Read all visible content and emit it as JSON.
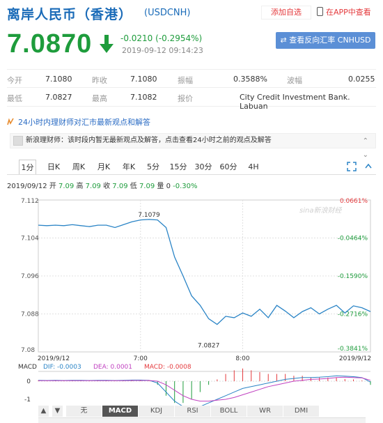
{
  "header": {
    "title": "离岸人民币（香港）",
    "code": "(USDCNH)",
    "add_favorite": "添加自选",
    "app_view": "在APP中查看"
  },
  "quote": {
    "price": "7.0870",
    "change": "-0.0210 (-0.2954%)",
    "timestamp": "2019-09-12 09:14:23",
    "reverse_button": "查看反向汇率 CNHUSD"
  },
  "stats": {
    "row1": [
      {
        "label": "今开",
        "value": "7.1080"
      },
      {
        "label": "昨收",
        "value": "7.1080"
      },
      {
        "label": "振幅",
        "value": "0.3588%"
      },
      {
        "label": "波幅",
        "value": "0.0255"
      }
    ],
    "row2": [
      {
        "label": "最低",
        "value": "7.0827"
      },
      {
        "label": "最高",
        "value": "7.1082"
      },
      {
        "label": "报价",
        "value": "City Credit Investment Bank. Labuan"
      }
    ]
  },
  "expert": {
    "heading": "24小时内理财师对汇市最新观点和解答",
    "notice": "新浪理财师：该时段内暂无最新观点及解答，点击查看24小时之前的观点及解答"
  },
  "tabs": [
    "1分",
    "日K",
    "周K",
    "月K",
    "年K",
    "5分",
    "15分",
    "30分",
    "60分",
    "4H"
  ],
  "active_tab": "1分",
  "ohlc_line": {
    "date": "2019/09/12",
    "open_label": "开",
    "open": "7.09",
    "high_label": "高",
    "high": "7.09",
    "close_label": "收",
    "close": "7.09",
    "low_label": "低",
    "low": "7.09",
    "vol_label": "量",
    "vol": "0",
    "pct": "-0.30%"
  },
  "chart_data": {
    "type": "line",
    "x": [
      "6:00",
      "6:05",
      "6:10",
      "6:15",
      "6:20",
      "6:25",
      "6:30",
      "6:35",
      "6:40",
      "6:45",
      "6:50",
      "6:55",
      "7:00",
      "7:05",
      "7:10",
      "7:15",
      "7:20",
      "7:25",
      "7:30",
      "7:35",
      "7:40",
      "7:45",
      "7:50",
      "7:55",
      "8:00",
      "8:05",
      "8:10",
      "8:15",
      "8:20",
      "8:25",
      "8:30",
      "8:35",
      "8:40",
      "8:45",
      "8:50",
      "8:55",
      "9:00",
      "9:05",
      "9:10",
      "9:15"
    ],
    "series": [
      {
        "values": [
          7.1067,
          7.1066,
          7.1067,
          7.1066,
          7.1068,
          7.1066,
          7.1064,
          7.1067,
          7.1067,
          7.1062,
          7.1068,
          7.1074,
          7.1078,
          7.1079,
          7.1078,
          7.1062,
          7.1,
          7.096,
          7.0918,
          7.0898,
          7.087,
          7.0858,
          7.0875,
          7.0872,
          7.0882,
          7.0875,
          7.089,
          7.0872,
          7.0898,
          7.0886,
          7.0872,
          7.0885,
          7.0893,
          7.088,
          7.089,
          7.0898,
          7.0882,
          7.0897,
          7.0893,
          7.0885
        ]
      }
    ],
    "ylim": [
      7.08,
      7.112
    ],
    "yticks": [
      "7.112",
      "7.104",
      "7.096",
      "7.088",
      "7.08"
    ],
    "pct_ticks": [
      "0.0661%",
      "-0.0464%",
      "-0.1590%",
      "-0.2716%",
      "-0.3841%"
    ],
    "xticks": [
      "2019/9/12",
      "7:00",
      "8:00",
      "2019/9/12"
    ],
    "annotations": [
      {
        "label": "7.1079",
        "x": "7:05",
        "y": 7.1079
      },
      {
        "label": "7.0827",
        "x": "7:40",
        "y": 7.0827
      }
    ],
    "watermark": "sina新浪财经"
  },
  "macd": {
    "label": "MACD",
    "dif": "DIF: -0.0003",
    "dea": "DEA: 0.0001",
    "macd_val": "MACD: -0.0008",
    "yticks": [
      "0",
      "-1"
    ],
    "dif_values": [
      0.05,
      0.04,
      0.05,
      0.04,
      0.05,
      0.05,
      0.04,
      0.05,
      0.05,
      0.04,
      0.05,
      0.06,
      0.06,
      0.05,
      -0.1,
      -0.6,
      -1.1,
      -1.4,
      -1.5,
      -1.4,
      -1.2,
      -1.0,
      -0.8,
      -0.6,
      -0.4,
      -0.3,
      -0.2,
      -0.1,
      0.0,
      0.1,
      0.15,
      0.2,
      0.2,
      0.22,
      0.25,
      0.3,
      0.28,
      0.25,
      0.2,
      -0.05
    ],
    "dea_values": [
      0.03,
      0.03,
      0.03,
      0.03,
      0.03,
      0.03,
      0.03,
      0.03,
      0.03,
      0.03,
      0.03,
      0.04,
      0.04,
      0.04,
      0.0,
      -0.2,
      -0.5,
      -0.8,
      -1.0,
      -1.1,
      -1.1,
      -1.05,
      -1.0,
      -0.9,
      -0.75,
      -0.6,
      -0.45,
      -0.3,
      -0.2,
      -0.1,
      0.0,
      0.05,
      0.1,
      0.12,
      0.15,
      0.2,
      0.22,
      0.2,
      0.18,
      0.05
    ]
  },
  "indicator_tabs": [
    "无",
    "MACD",
    "KDJ",
    "RSI",
    "BOLL",
    "WR",
    "DMI"
  ],
  "active_indicator": "MACD",
  "colors": {
    "up": "#e4393c",
    "down": "#1e9c3c",
    "line": "#2a84c6",
    "blue": "#1a6bb8"
  }
}
